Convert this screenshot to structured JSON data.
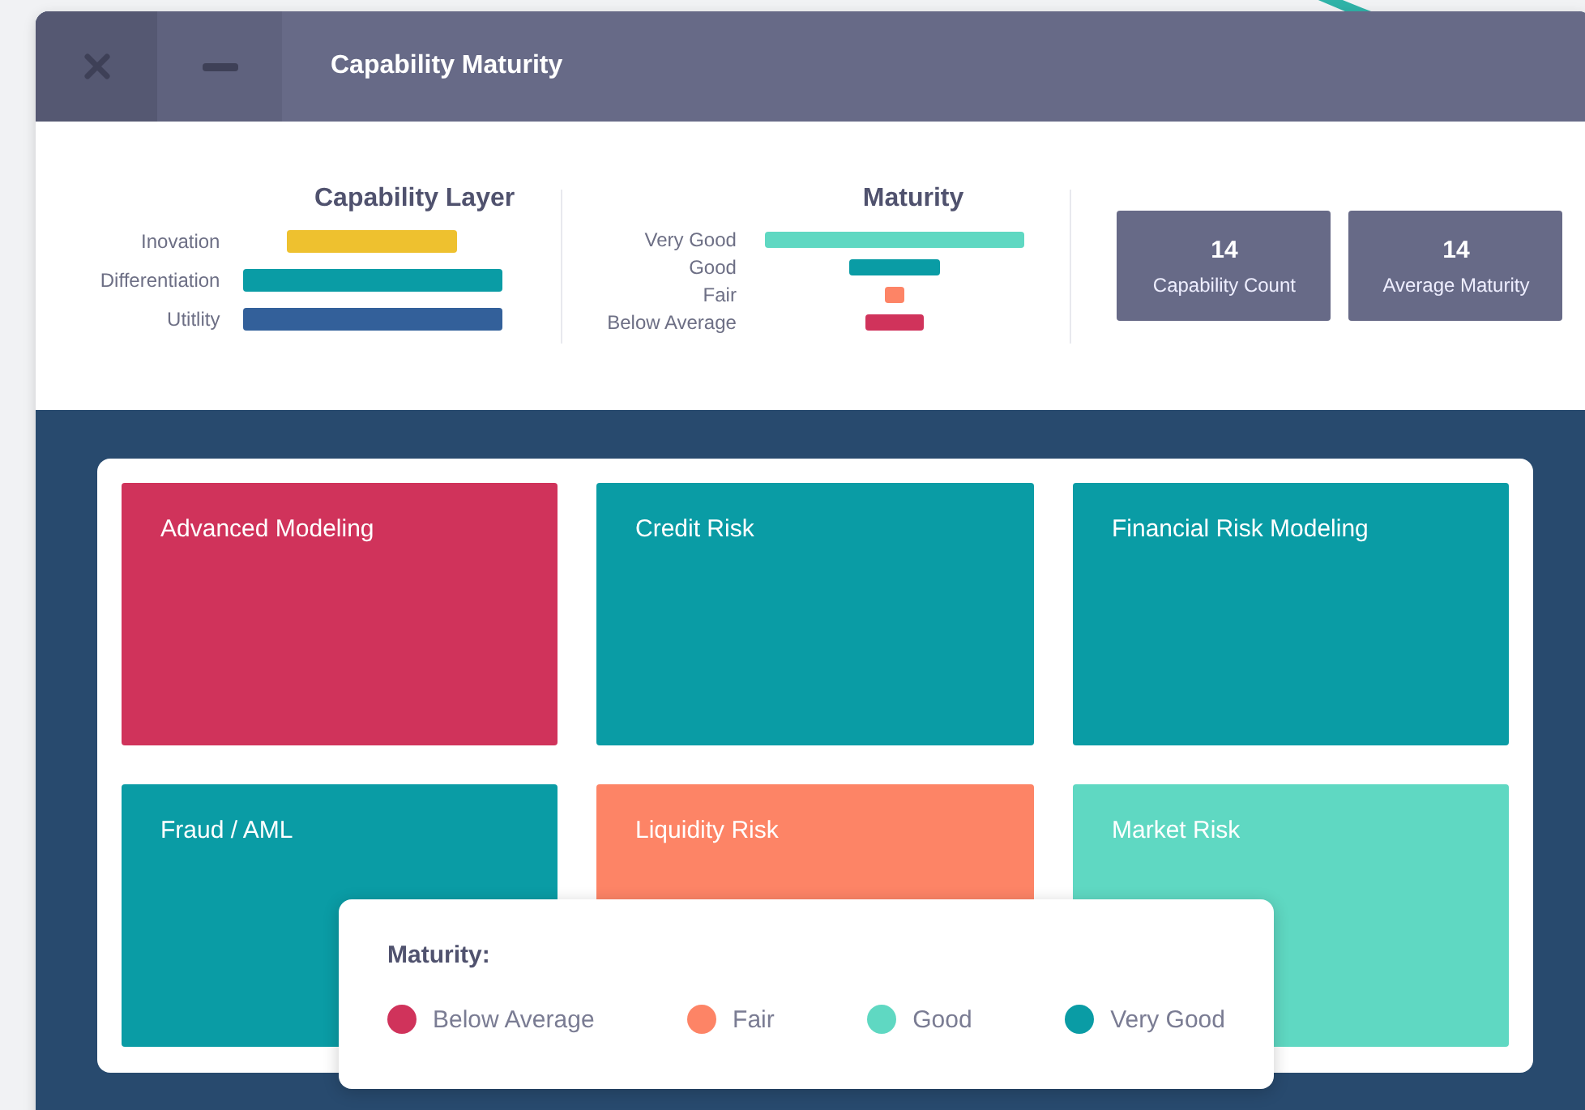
{
  "window": {
    "title": "Capability Maturity"
  },
  "capability_layer": {
    "title": "Capability Layer",
    "bars": [
      {
        "label": "Inovation",
        "color": "#eec12f"
      },
      {
        "label": "Differentiation",
        "color": "#0a9ca5"
      },
      {
        "label": "Utitlity",
        "color": "#33609a"
      }
    ]
  },
  "maturity": {
    "title": "Maturity",
    "bars": [
      {
        "label": "Very Good",
        "color": "#5fd8c2"
      },
      {
        "label": "Good",
        "color": "#0a9ca5"
      },
      {
        "label": "Fair",
        "color": "#fd8466"
      },
      {
        "label": "Below Average",
        "color": "#d0335b"
      }
    ]
  },
  "stats": [
    {
      "value": "14",
      "label": "Capability Count"
    },
    {
      "value": "14",
      "label": "Average Maturity"
    }
  ],
  "tiles": [
    {
      "name": "Advanced Modeling",
      "color": "#d0335b"
    },
    {
      "name": "Credit Risk",
      "color": "#0a9ca5"
    },
    {
      "name": "Financial Risk Modeling",
      "color": "#0a9ca5"
    },
    {
      "name": "Fraud / AML",
      "color": "#0a9ca5"
    },
    {
      "name": "Liquidity Risk",
      "color": "#fd8466"
    },
    {
      "name": "Market Risk",
      "color": "#5fd8c2"
    }
  ],
  "legend": {
    "title": "Maturity:",
    "items": [
      {
        "label": "Below Average",
        "color": "#d0335b"
      },
      {
        "label": "Fair",
        "color": "#fd8466"
      },
      {
        "label": "Good",
        "color": "#5fd8c2"
      },
      {
        "label": "Very Good",
        "color": "#0a9ca5"
      }
    ]
  }
}
